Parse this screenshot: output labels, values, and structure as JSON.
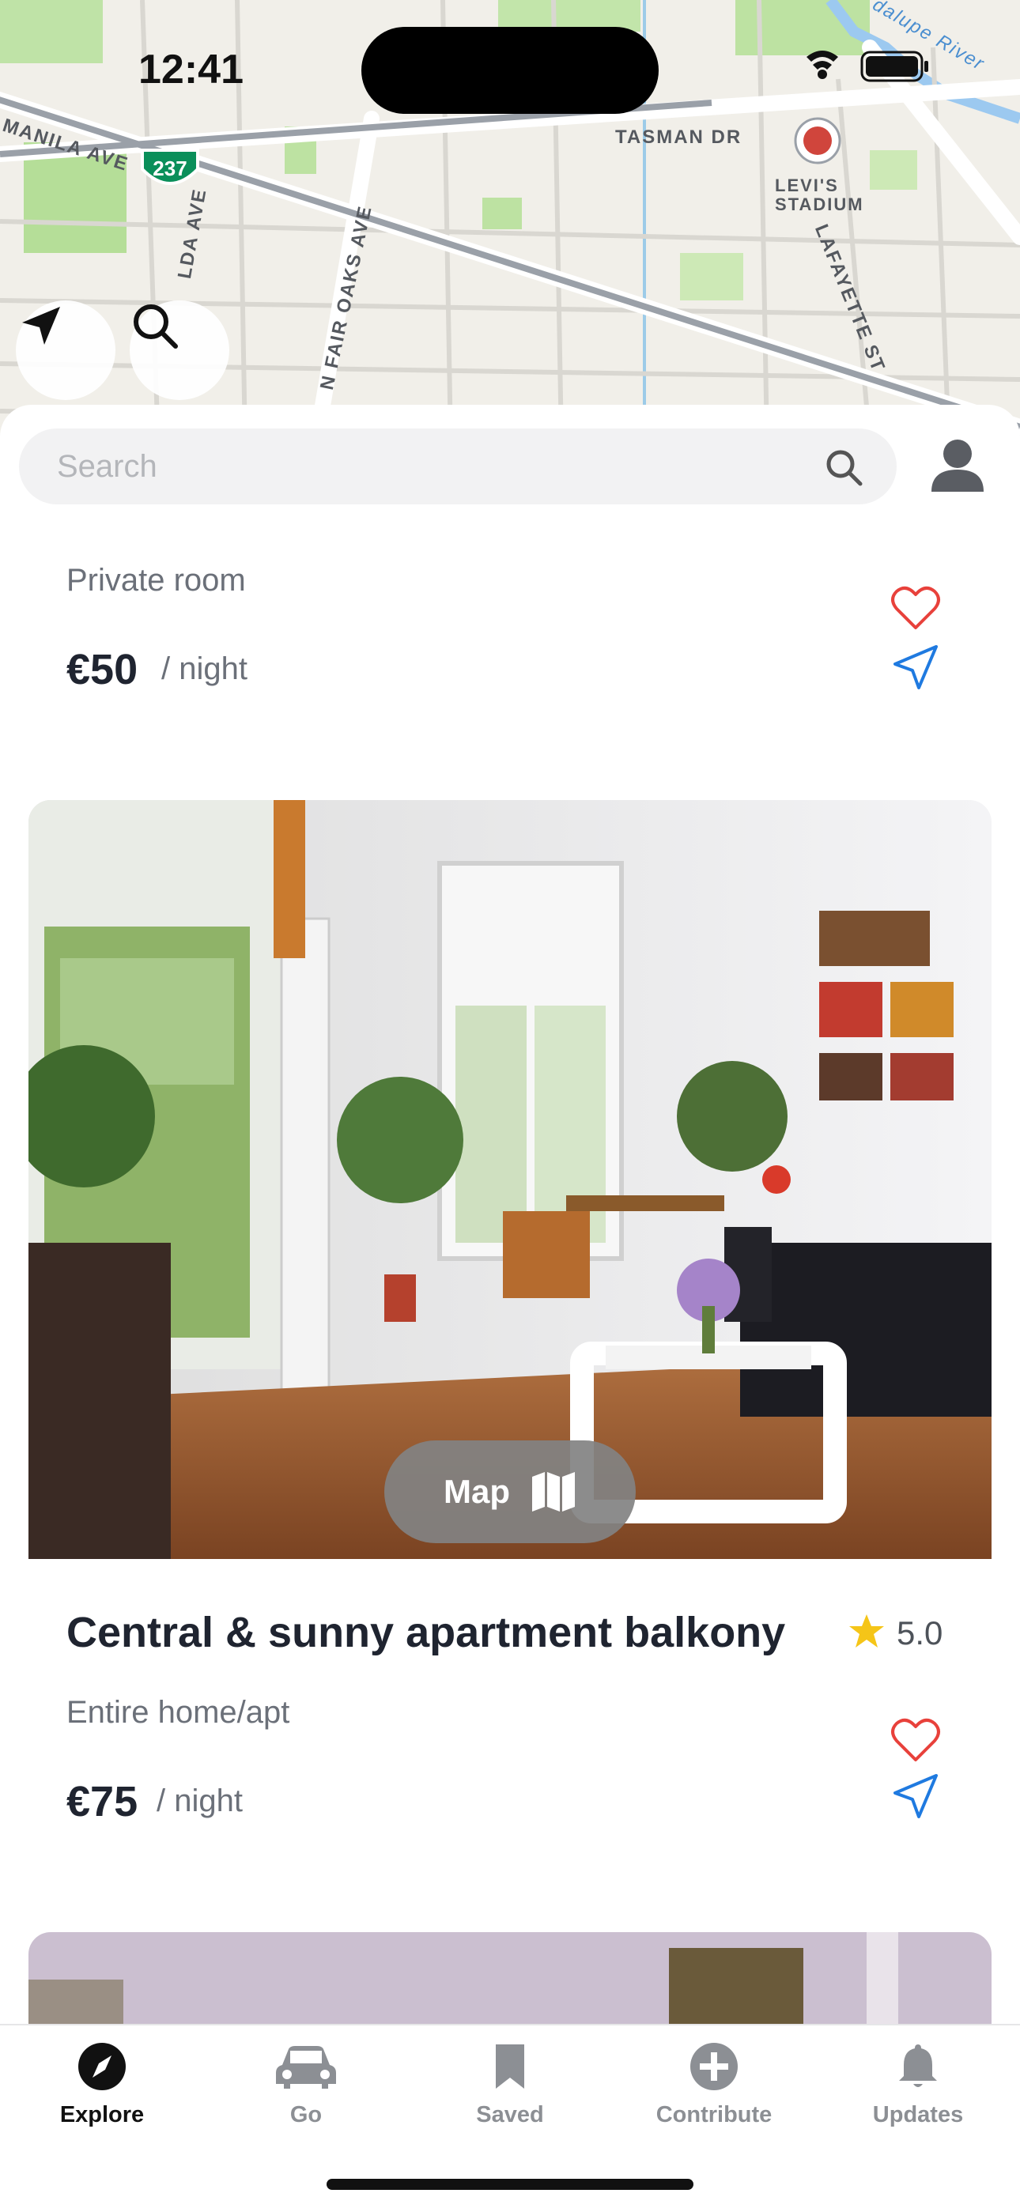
{
  "status_bar": {
    "time": "12:41"
  },
  "map": {
    "labels": {
      "manila": "MANILA AVE",
      "highway": "237",
      "tasman": "TASMAN DR",
      "levis1": "LEVI'S",
      "levis2": "STADIUM",
      "lafayette": "LAFAYETTE ST",
      "lda": "LDA AVE",
      "fair_oaks": "N FAIR OAKS AVE",
      "river": "dalupe River"
    },
    "buttons": {
      "locate_icon": "location-arrow-icon",
      "search_icon": "search-icon"
    }
  },
  "search": {
    "placeholder": "Search"
  },
  "listings": [
    {
      "type": "Private room",
      "price": "€50",
      "per": "/ night"
    },
    {
      "title": "Central & sunny apartment balkony",
      "rating": "5.0",
      "type": "Entire home/apt",
      "price": "€75",
      "per": "/ night"
    }
  ],
  "map_button": {
    "label": "Map"
  },
  "tabs": [
    {
      "label": "Explore",
      "icon": "compass-icon",
      "active": true
    },
    {
      "label": "Go",
      "icon": "car-icon"
    },
    {
      "label": "Saved",
      "icon": "bookmark-icon"
    },
    {
      "label": "Contribute",
      "icon": "plus-circle-icon"
    },
    {
      "label": "Updates",
      "icon": "bell-icon"
    }
  ],
  "colors": {
    "heart": "#e8413b",
    "navigate": "#1f7ae0",
    "star": "#f5c518",
    "tab_active": "#111111",
    "tab_inactive": "#8c8f94"
  }
}
